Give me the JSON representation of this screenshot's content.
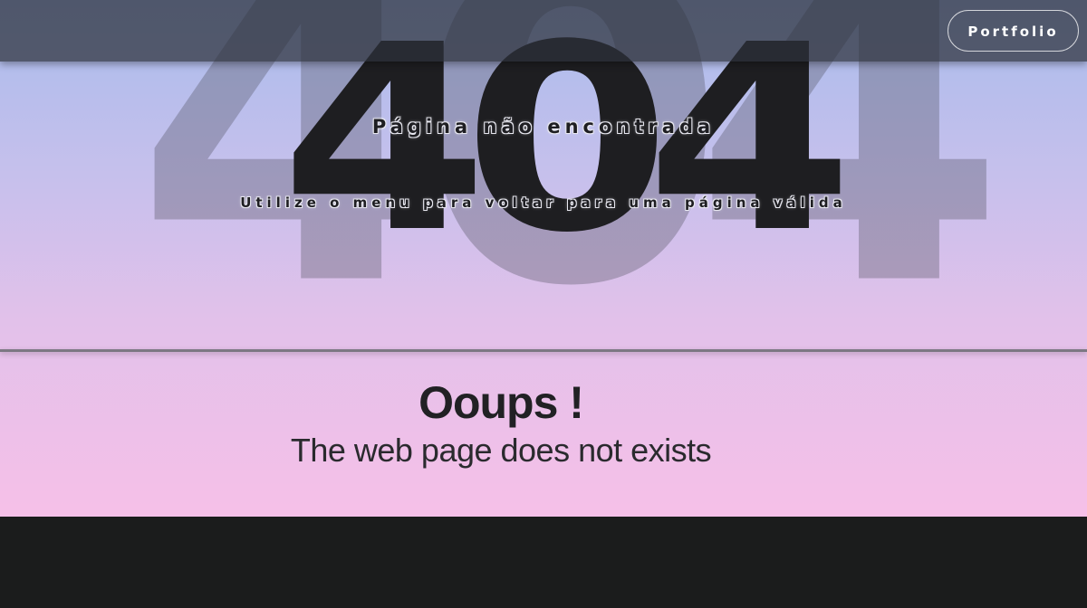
{
  "hero": {
    "error_code": "404",
    "error_code_ghost": "404",
    "subtitle": "Página não encontrada",
    "hint": "Utilize o menu para voltar para uma página válida"
  },
  "nav": {
    "portfolio_label": "Portfolio"
  },
  "message": {
    "title": "Ooups !",
    "body": "The web page does not exists"
  },
  "colors": {
    "gradient_top": "#a9bcec",
    "gradient_bottom": "#f6c0e8",
    "dark_text": "#1e1e21",
    "footer_background": "#1b1c1c"
  }
}
